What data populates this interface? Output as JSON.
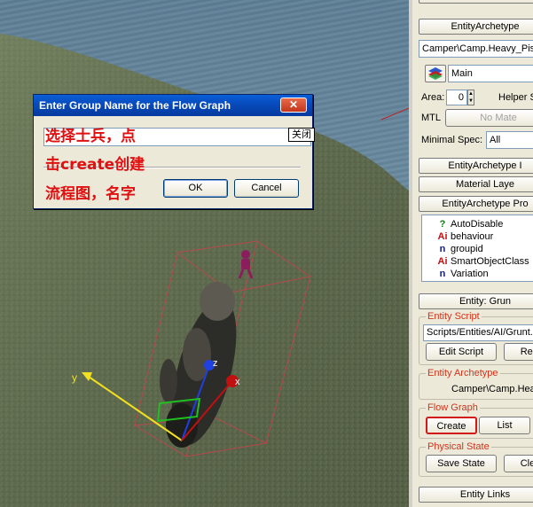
{
  "dialog": {
    "title": "Enter Group Name for the Flow Graph",
    "input_value": "",
    "ime_tooltip": "关闭",
    "ok_label": "OK",
    "cancel_label": "Cancel",
    "annotations": [
      "选择士兵，点",
      "击create创建",
      "流程图，名字"
    ]
  },
  "viewport": {
    "axis_labels": {
      "x": "x",
      "y": "y",
      "z": "z"
    }
  },
  "panel": {
    "entity_archetype_header": "EntityArchetype",
    "archetype_path": "Camper\\Camp.Heavy_Pistol",
    "layer_value": "Main",
    "area_label": "Area:",
    "area_value": "0",
    "helper_label": "Helper S",
    "mtl_label": "MTL",
    "mtl_value": "No Mate",
    "minspec_label": "Minimal Spec:",
    "minspec_value": "All",
    "archetype_info_header": "EntityArchetype I",
    "material_layers_header": "Material Laye",
    "archetype_props_header": "EntityArchetype Pro",
    "properties": [
      {
        "icon": "?",
        "icon_name": "help-icon",
        "name": "AutoDisable"
      },
      {
        "icon": "Ai",
        "icon_name": "ai-icon",
        "name": "behaviour"
      },
      {
        "icon": "n",
        "icon_name": "number-icon",
        "name": "groupid"
      },
      {
        "icon": "Ai",
        "icon_name": "ai-icon",
        "name": "SmartObjectClass"
      },
      {
        "icon": "n",
        "icon_name": "number-icon",
        "name": "Variation"
      }
    ],
    "entity_header": "Entity: Grun",
    "entity_script_title": "Entity Script",
    "script_path": "Scripts/Entities/AI/Grunt.l",
    "edit_script_label": "Edit Script",
    "reload_label": "Relo",
    "entity_archetype_title": "Entity Archetype",
    "archetype_value": "Camper\\Camp.Heav",
    "flow_graph_title": "Flow Graph",
    "create_label": "Create",
    "list_label": "List",
    "physical_state_title": "Physical State",
    "save_state_label": "Save State",
    "clear_label": "Clea",
    "entity_links_header": "Entity Links"
  },
  "colors": {
    "annotation": "#e01010",
    "group_title": "#d2331c",
    "titlebar": "#0748b8"
  }
}
